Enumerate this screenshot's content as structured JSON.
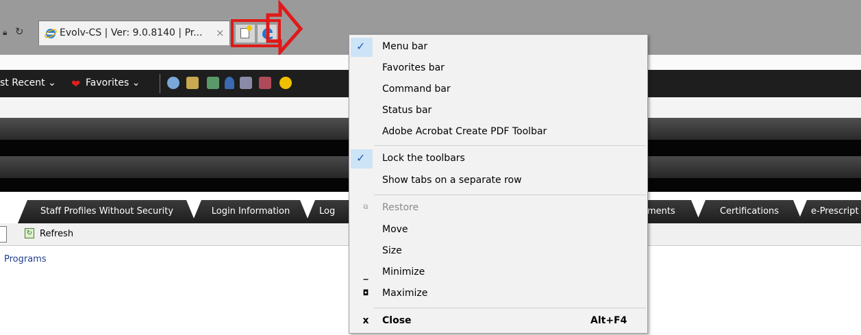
{
  "browser": {
    "tab_title": "Evolv-CS | Ver: 9.0.8140 | Pr...",
    "tab_close_glyph": "×"
  },
  "favorites_bar": {
    "most_recent": "st Recent ⌄",
    "favorites": "Favorites ⌄"
  },
  "app_tabs": [
    "Staff Profiles Without Security",
    "Login Information",
    "Log",
    "ments",
    "Certifications",
    "e-Prescript"
  ],
  "toolbar": {
    "refresh_label": "Refresh",
    "refresh_icon": "refresh-icon"
  },
  "programs_link": "Programs",
  "context_menu": {
    "items": [
      {
        "label": "Menu bar",
        "checked": true
      },
      {
        "label": "Favorites bar"
      },
      {
        "label": "Command bar"
      },
      {
        "label": "Status bar"
      },
      {
        "label": "Adobe Acrobat Create PDF Toolbar"
      },
      {
        "label": "Lock the toolbars",
        "checked": true
      },
      {
        "label": "Show tabs on a separate row"
      },
      {
        "label": "Restore",
        "disabled": true,
        "icon": "restore-icon"
      },
      {
        "label": "Move"
      },
      {
        "label": "Size"
      },
      {
        "label": "Minimize",
        "icon": "minimize-icon"
      },
      {
        "label": "Maximize",
        "icon": "maximize-icon"
      },
      {
        "label": "Close",
        "icon": "close-icon",
        "shortcut": "Alt+F4"
      }
    ]
  },
  "colors": {
    "highlight_red": "#e01919",
    "checkbox_bg": "#cde4f7",
    "menu_bg": "#f2f2f2"
  }
}
